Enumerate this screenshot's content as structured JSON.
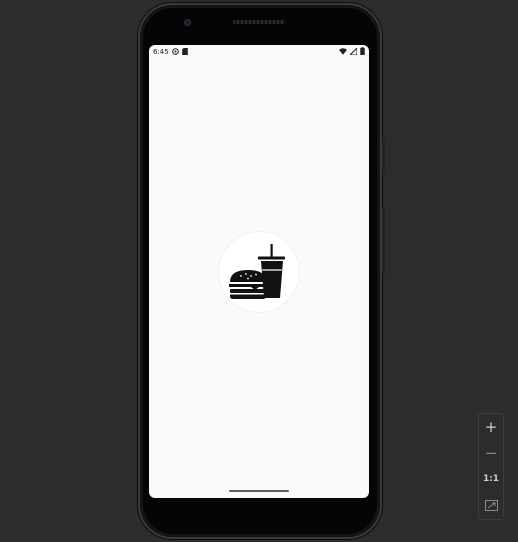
{
  "status_bar": {
    "time": "6:45",
    "left_icons": [
      "settings-gear-icon",
      "sd-card-icon"
    ],
    "right_icons": [
      "wifi-icon",
      "cell-signal-icon",
      "battery-icon"
    ]
  },
  "app": {
    "splash_icon": "burger-and-drink-icon"
  },
  "zoom_controls": {
    "zoom_in_label": "+",
    "zoom_out_label": "−",
    "actual_size_label": "1:1",
    "fit_screen_icon": "fit-screen-icon"
  },
  "colors": {
    "background": "#2b2c2e",
    "screen": "#fafafa",
    "icon": "#111111"
  }
}
